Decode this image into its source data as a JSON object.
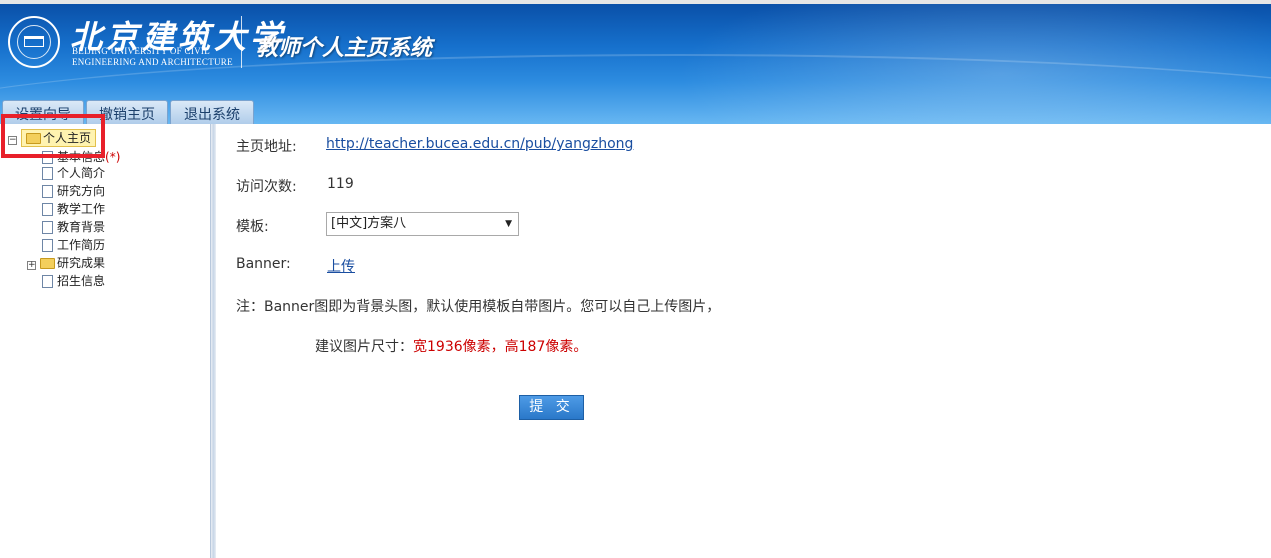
{
  "header": {
    "university_cn": "北京建筑大学",
    "university_en_line1": "BEIJING UNIVERSITY OF CIVIL",
    "university_en_line2": "ENGINEERING AND ARCHITECTURE",
    "system_title": "教师个人主页系统"
  },
  "tabs": [
    {
      "label": "设置向导"
    },
    {
      "label": "撤销主页"
    },
    {
      "label": "退出系统"
    }
  ],
  "tree": {
    "root": {
      "label": "个人主页",
      "expander": "⊟"
    },
    "items": [
      {
        "label": "基本信息",
        "suffix": "(*)"
      },
      {
        "label": "个人简介"
      },
      {
        "label": "研究方向"
      },
      {
        "label": "教学工作"
      },
      {
        "label": "教育背景"
      },
      {
        "label": "工作简历"
      },
      {
        "label": "研究成果",
        "expander": "+"
      },
      {
        "label": "招生信息"
      }
    ]
  },
  "form": {
    "homepage_label": "主页地址:",
    "homepage_url": "http://teacher.bucea.edu.cn/pub/yangzhong",
    "visits_label": "访问次数:",
    "visits_value": "119",
    "template_label": "模板:",
    "template_value": "[中文]方案八",
    "banner_label": "Banner:",
    "banner_upload": "上传",
    "note": "注：Banner图即为背景头图，默认使用模板自带图片。您可以自己上传图片，",
    "size_prefix": "建议图片尺寸：",
    "size_value": "宽1936像素，高187像素。",
    "submit_label": "提 交"
  },
  "colors": {
    "header_blue": "#1670cc",
    "link_blue": "#1a4ea0",
    "highlight_red": "#e8202a",
    "note_red": "#cc0000"
  }
}
